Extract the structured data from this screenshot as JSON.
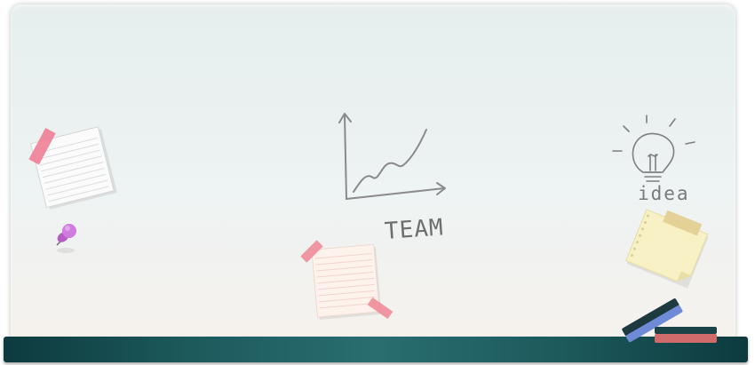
{
  "sketch": {
    "chart_caption": "TEAM",
    "bulb_caption": "idea"
  },
  "icons": {
    "growth_chart": "line-chart-sketch-icon",
    "lightbulb": "lightbulb-sketch-icon",
    "pushpin": "pushpin-icon",
    "sticky_notes": "sticky-note-icon",
    "eraser": "eraser-icon",
    "chalk": "chalk-icon"
  },
  "colors": {
    "board": "#eaf0f0",
    "tray": "#1c5a5c",
    "sketch_line": "#8a8a8a",
    "tape_pink": "#f08a9c",
    "pin_purple": "#c46fd3",
    "yellow_note": "#f7f0c4"
  }
}
